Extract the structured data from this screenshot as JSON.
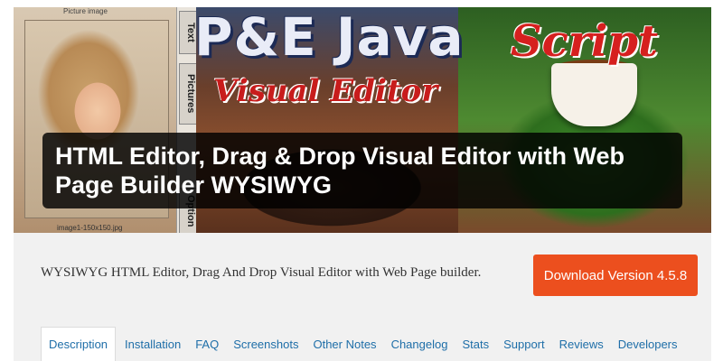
{
  "banner": {
    "preview_caption_top": "Picture image",
    "preview_caption_bottom": "image1-150x150.jpg",
    "side_tabs": [
      "Text",
      "Pictures",
      "Option"
    ],
    "title_main": "P&E Java",
    "title_script": "Script",
    "title_sub": "Visual Editor",
    "headline": "HTML Editor, Drag & Drop Visual Editor with Web Page Builder WYSIWYG"
  },
  "plugin": {
    "short_description": "WYSIWYG HTML Editor, Drag And Drop Visual Editor with Web Page builder.",
    "download_label": "Download Version 4.5.8"
  },
  "tabs": [
    {
      "label": "Description",
      "active": true
    },
    {
      "label": "Installation"
    },
    {
      "label": "FAQ"
    },
    {
      "label": "Screenshots"
    },
    {
      "label": "Other Notes"
    },
    {
      "label": "Changelog"
    },
    {
      "label": "Stats"
    },
    {
      "label": "Support"
    },
    {
      "label": "Reviews"
    },
    {
      "label": "Developers"
    }
  ],
  "colors": {
    "download_button": "#ec4f1e",
    "tab_link": "#1e6ea8",
    "header_bg": "#f1f1f1"
  }
}
